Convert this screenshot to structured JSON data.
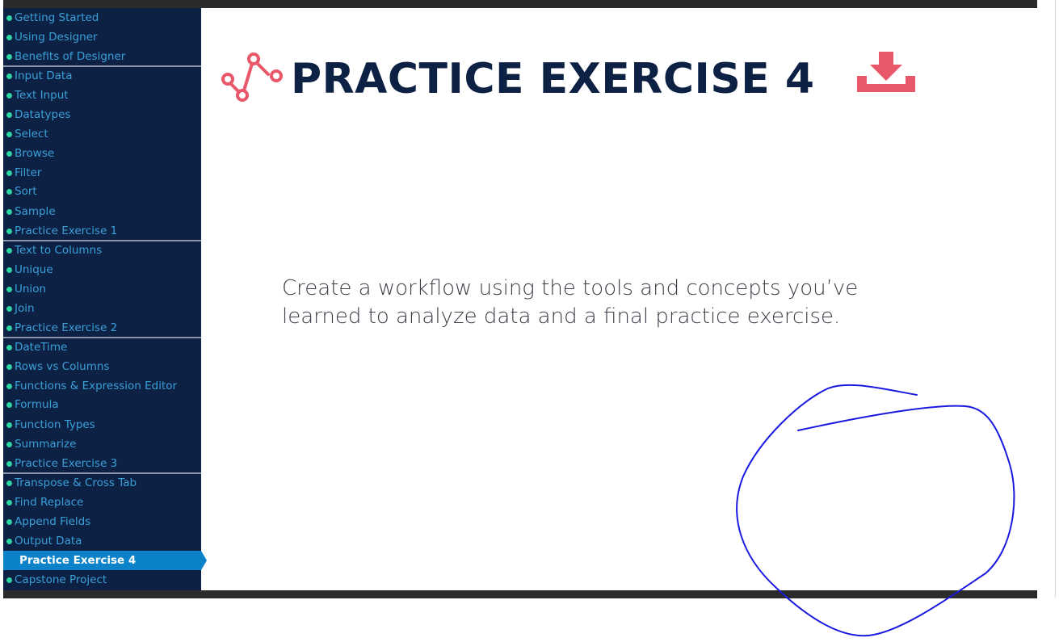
{
  "sidebar": {
    "items": [
      {
        "label": "Getting Started"
      },
      {
        "label": "Using Designer"
      },
      {
        "label": "Benefits of Designer"
      },
      {
        "label": "Input Data"
      },
      {
        "label": "Text Input"
      },
      {
        "label": "Datatypes"
      },
      {
        "label": "Select"
      },
      {
        "label": "Browse"
      },
      {
        "label": "Filter"
      },
      {
        "label": "Sort"
      },
      {
        "label": "Sample"
      },
      {
        "label": "Practice Exercise 1"
      },
      {
        "label": "Text to Columns"
      },
      {
        "label": "Unique"
      },
      {
        "label": "Union"
      },
      {
        "label": "Join"
      },
      {
        "label": "Practice Exercise 2"
      },
      {
        "label": "DateTime"
      },
      {
        "label": "Rows vs Columns"
      },
      {
        "label": "Functions & Expression Editor"
      },
      {
        "label": "Formula"
      },
      {
        "label": "Function Types"
      },
      {
        "label": "Summarize"
      },
      {
        "label": "Practice Exercise 3"
      },
      {
        "label": "Transpose & Cross Tab"
      },
      {
        "label": "Find Replace"
      },
      {
        "label": "Append Fields"
      },
      {
        "label": "Output Data"
      },
      {
        "label": "Practice Exercise 4"
      },
      {
        "label": "Capstone Project"
      }
    ],
    "active_item": "Practice Exercise 4"
  },
  "main": {
    "title": "PRACTICE EXERCISE 4",
    "title_icon": "workflow-icon",
    "download_icon": "download-icon",
    "description_line1": "Create a workflow using the tools and concepts you’ve",
    "description_line2": "learned to analyze data and a final practice exercise."
  },
  "annotation": {
    "type": "hand-drawn-circle",
    "color": "#1a1adf"
  },
  "colors": {
    "sidebar_bg": "#0d2144",
    "nav_text": "#3aa0d8",
    "bullet": "#2ed3a2",
    "active_bg": "#0c83c9",
    "title": "#0d2144",
    "accent": "#e8586a"
  }
}
